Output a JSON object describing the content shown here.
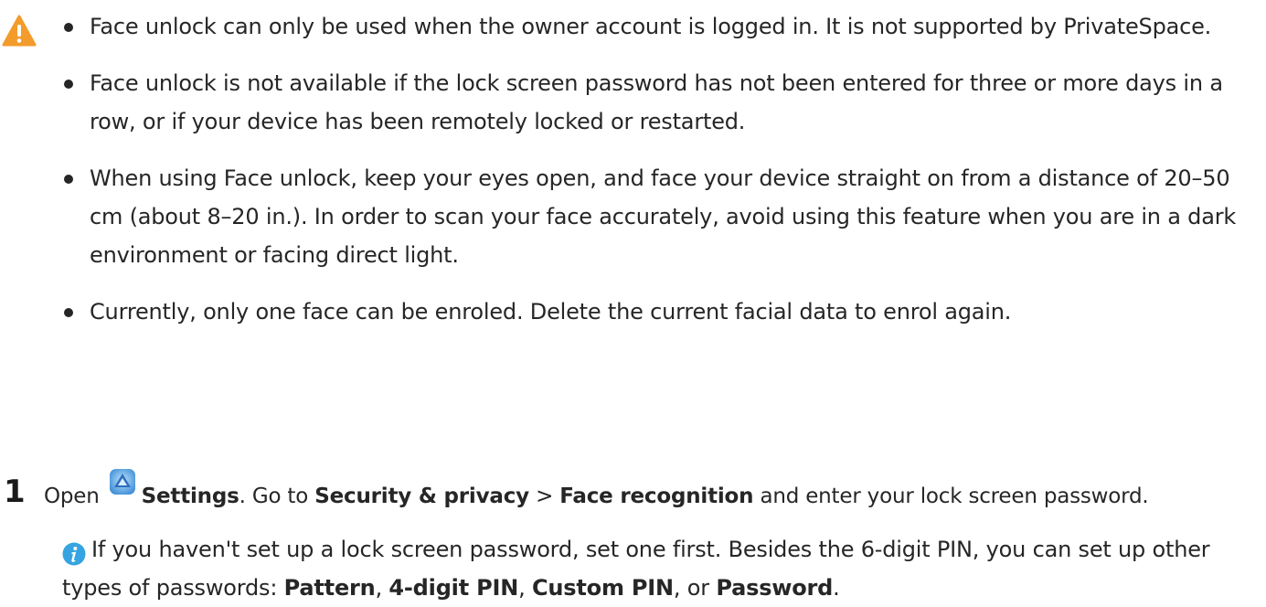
{
  "warning_list": {
    "icon": "warning-icon",
    "accent": "#f39b2b",
    "items": [
      "Face unlock can only be used when the owner account is logged in. It is not supported by PrivateSpace.",
      "Face unlock is not available if the lock screen password has not been entered for three or more days in a row, or if your device has been remotely locked or restarted.",
      "When using Face unlock, keep your eyes open, and face your device straight on from a distance of 20–50 cm (about 8–20 in.). In order to scan your face accurately, avoid using this feature when you are in a dark environment or facing direct light.",
      "Currently, only one face can be enroled. Delete the current facial data to enrol again."
    ]
  },
  "step1": {
    "number": "1",
    "open": "Open",
    "settings_icon": "settings-app-icon",
    "settings": "Settings",
    "go_to": ". Go to ",
    "security": "Security & privacy",
    "sep": " > ",
    "face_recognition": "Face recognition",
    "rest": " and enter your lock screen password."
  },
  "note": {
    "icon": "info-icon",
    "accent": "#35a4e0",
    "text_a": "If you haven't set up a lock screen password, set one first. Besides the 6-digit PIN, you can set up other types of passwords: ",
    "pattern": "Pattern",
    "c1": ", ",
    "four_digit_pin": "4-digit PIN",
    "c2": ", ",
    "custom_pin": "Custom PIN",
    "or": ", or ",
    "password": "Password",
    "end": "."
  }
}
